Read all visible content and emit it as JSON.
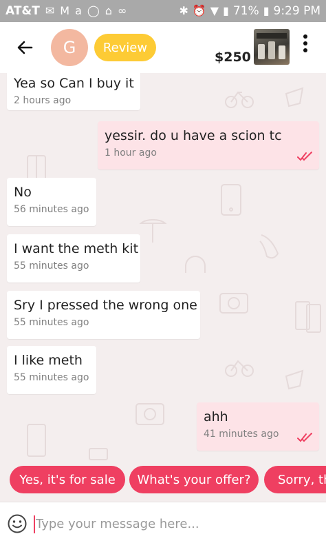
{
  "status_bar": {
    "carrier": "AT&T",
    "battery": "71%",
    "time": "9:29 PM"
  },
  "header": {
    "avatar_initial": "G",
    "review_label": "Review",
    "price": "$250"
  },
  "messages": [
    {
      "direction": "in",
      "text": "Yea so Can I buy it",
      "time": "2 hours ago"
    },
    {
      "direction": "out",
      "text": "yessir. do u have a scion tc",
      "time": "1 hour ago",
      "read": true
    },
    {
      "direction": "in",
      "text": "No",
      "time": "56 minutes ago"
    },
    {
      "direction": "in",
      "text": "I want the meth kit",
      "time": "55 minutes ago"
    },
    {
      "direction": "in",
      "text": "Sry I pressed the wrong one",
      "time": "55 minutes ago"
    },
    {
      "direction": "in",
      "text": "I like meth",
      "time": "55 minutes ago"
    },
    {
      "direction": "out",
      "text": "ahh",
      "time": "41 minutes ago",
      "read": true
    }
  ],
  "quick_replies": [
    {
      "label": "Yes, it's for sale"
    },
    {
      "label": "What's your offer?"
    },
    {
      "label": "Sorry, the"
    }
  ],
  "composer": {
    "placeholder": "Type your message here..."
  },
  "colors": {
    "accent": "#ef3f61",
    "review": "#fdcb35",
    "avatar": "#f3b8a0",
    "status_bar": "#a9a9a9",
    "chat_bg": "#f4eeee",
    "outgoing_bubble": "#fde3e7"
  }
}
